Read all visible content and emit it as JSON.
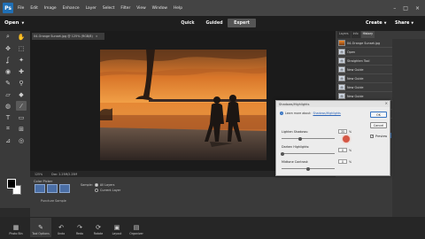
{
  "menubar": {
    "logo": "Ps",
    "items": [
      "File",
      "Edit",
      "Image",
      "Enhance",
      "Layer",
      "Select",
      "Filter",
      "View",
      "Window",
      "Help"
    ]
  },
  "modebar": {
    "open_label": "Open",
    "tabs": [
      "Quick",
      "Guided",
      "Expert"
    ],
    "create_label": "Create",
    "share_label": "Share"
  },
  "document": {
    "tab_title": "04-Orange Sunset.jpg @ 125% (RGB/8)",
    "zoom": "125%",
    "doc_size": "Doc: 2.25M/2.25M"
  },
  "tool_options": {
    "title": "Color Picker",
    "sample_label": "Sample:",
    "sample_options": [
      "All Layers",
      "Current Layer"
    ],
    "sample_selected": "All Layers",
    "puncture_label": "Puncture Sample"
  },
  "bottombar": {
    "items": [
      {
        "icon": "photo-bin-icon",
        "label": "Photo Bin"
      },
      {
        "icon": "tool-options-icon",
        "label": "Tool Options"
      },
      {
        "icon": "undo-icon",
        "label": "Undo"
      },
      {
        "icon": "redo-icon",
        "label": "Redo"
      },
      {
        "icon": "rotate-icon",
        "label": "Rotate"
      },
      {
        "icon": "layout-icon",
        "label": "Layout"
      },
      {
        "icon": "organizer-icon",
        "label": "Organizer"
      }
    ]
  },
  "panels": {
    "tabs": [
      "Layers",
      "Info",
      "History"
    ],
    "active_tab": "History",
    "history": [
      "04-Orange Sunset.jpg",
      "Open",
      "Straighten Tool",
      "New Guide",
      "New Guide",
      "New Guide",
      "New Guide",
      "New Guide",
      "New Guide"
    ]
  },
  "dialog": {
    "title": "Shadows/Highlights",
    "learn_prefix": "Learn more about:",
    "learn_link": "Shadows/Highlights",
    "ok_label": "OK",
    "cancel_label": "Cancel",
    "preview_label": "Preview",
    "preview_checked": true,
    "sliders": [
      {
        "label": "Lighten Shadows:",
        "value": "35",
        "unit": "%",
        "fraction": 0.35
      },
      {
        "label": "Darken Highlights:",
        "value": "0",
        "unit": "%",
        "fraction": 0.0
      },
      {
        "label": "Midtone Contrast:",
        "value": "0",
        "unit": "%",
        "fraction": 0.5
      }
    ]
  }
}
